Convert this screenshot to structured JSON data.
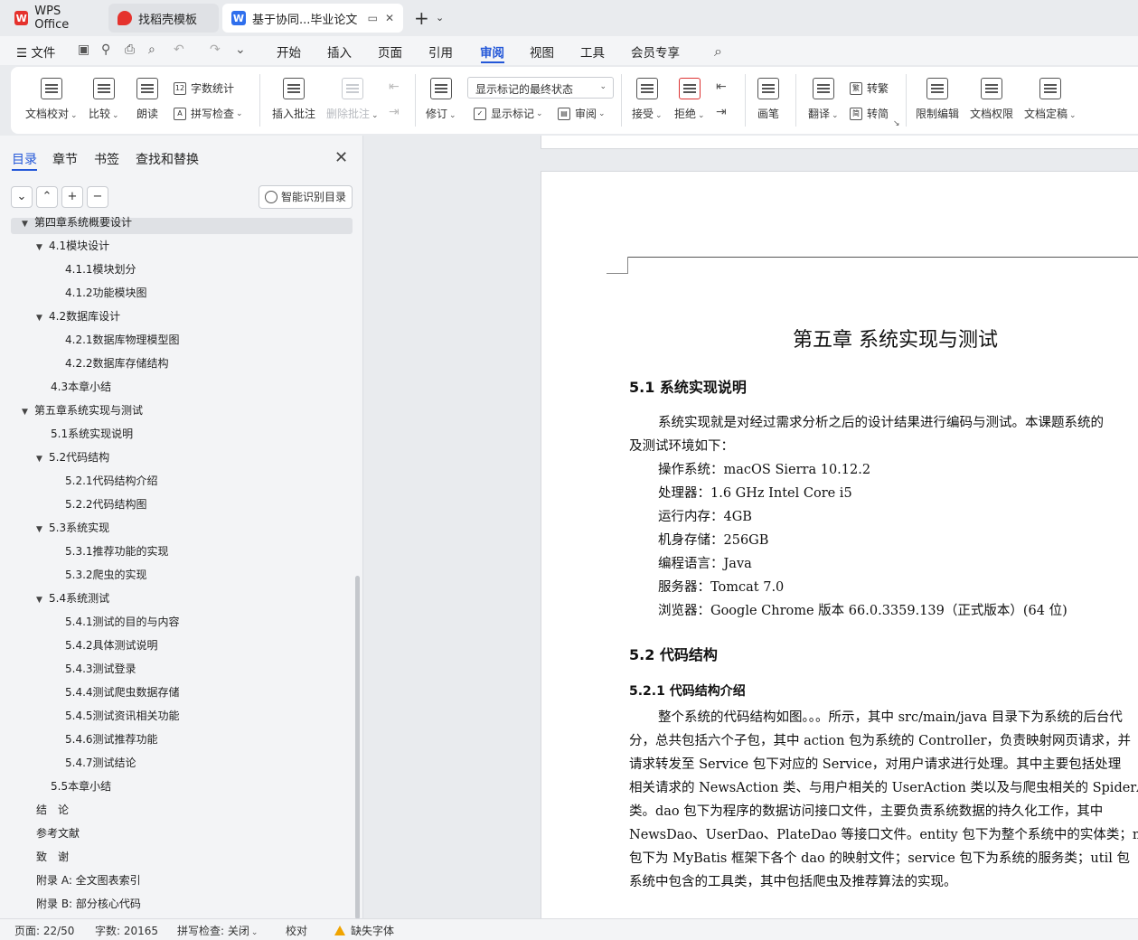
{
  "tabs": {
    "wps": "WPS Office",
    "templates": "找稻壳模板",
    "document": "基于协同...毕业论文"
  },
  "menubar": {
    "file": "文件",
    "items": [
      "开始",
      "插入",
      "页面",
      "引用",
      "审阅",
      "视图",
      "工具",
      "会员专享"
    ],
    "active": "审阅"
  },
  "ribbon": {
    "doc_proofread": "文档校对",
    "compare": "比较",
    "read_aloud": "朗读",
    "word_count": "字数统计",
    "spell_check": "拼写检查",
    "insert_comment": "插入批注",
    "delete_comment": "删除批注",
    "track_changes": "修订",
    "markup_state": "显示标记的最终状态",
    "show_markup": "显示标记",
    "review": "审阅",
    "accept": "接受",
    "reject": "拒绝",
    "pen": "画笔",
    "translate": "翻译",
    "to_traditional": "转繁",
    "to_simplified": "转简",
    "restrict_edit": "限制编辑",
    "doc_permission": "文档权限",
    "doc_finalize": "文档定稿"
  },
  "sidebar": {
    "tabs": [
      "目录",
      "章节",
      "书签",
      "查找和替换"
    ],
    "smart_toc": "智能识别目录",
    "toc": [
      {
        "label": "第四章系统概要设计",
        "level": 1,
        "caret": true
      },
      {
        "label": "4.1模块设计",
        "level": 2,
        "caret": true
      },
      {
        "label": "4.1.1模块划分",
        "level": 3,
        "caret": false
      },
      {
        "label": "4.1.2功能模块图",
        "level": 3,
        "caret": false
      },
      {
        "label": "4.2数据库设计",
        "level": 2,
        "caret": true
      },
      {
        "label": "4.2.1数据库物理模型图",
        "level": 3,
        "caret": false
      },
      {
        "label": "4.2.2数据库存储结构",
        "level": 3,
        "caret": false
      },
      {
        "label": "4.3本章小结",
        "level": 2,
        "caret": false
      },
      {
        "label": "第五章系统实现与测试",
        "level": 1,
        "caret": true
      },
      {
        "label": "5.1系统实现说明",
        "level": 2,
        "caret": false
      },
      {
        "label": "5.2代码结构",
        "level": 2,
        "caret": true
      },
      {
        "label": "5.2.1代码结构介绍",
        "level": 3,
        "caret": false
      },
      {
        "label": "5.2.2代码结构图",
        "level": 3,
        "caret": false
      },
      {
        "label": "5.3系统实现",
        "level": 2,
        "caret": true
      },
      {
        "label": "5.3.1推荐功能的实现",
        "level": 3,
        "caret": false
      },
      {
        "label": "5.3.2爬虫的实现",
        "level": 3,
        "caret": false
      },
      {
        "label": "5.4系统测试",
        "level": 2,
        "caret": true
      },
      {
        "label": "5.4.1测试的目的与内容",
        "level": 3,
        "caret": false
      },
      {
        "label": "5.4.2具体测试说明",
        "level": 3,
        "caret": false
      },
      {
        "label": "5.4.3测试登录",
        "level": 3,
        "caret": false
      },
      {
        "label": "5.4.4测试爬虫数据存储",
        "level": 3,
        "caret": false
      },
      {
        "label": "5.4.5测试资讯相关功能",
        "level": 3,
        "caret": false
      },
      {
        "label": "5.4.6测试推荐功能",
        "level": 3,
        "caret": false
      },
      {
        "label": "5.4.7测试结论",
        "level": 3,
        "caret": false
      },
      {
        "label": "5.5本章小结",
        "level": 2,
        "caret": false
      },
      {
        "label": "结　论",
        "level": 1,
        "caret": false
      },
      {
        "label": "参考文献",
        "level": 1,
        "caret": false
      },
      {
        "label": "致　谢",
        "level": 1,
        "caret": false
      },
      {
        "label": "附录 A:  全文图表索引",
        "level": 1,
        "caret": false
      },
      {
        "label": "附录 B:  部分核心代码",
        "level": 1,
        "caret": false
      }
    ]
  },
  "document": {
    "chapter_title": "第五章  系统实现与测试",
    "h_5_1": "5.1  系统实现说明",
    "p_5_1_line1": "系统实现就是对经过需求分析之后的设计结果进行编码与测试。本课题系统的",
    "p_5_1_line2": "及测试环境如下：",
    "env": [
      "操作系统：macOS Sierra 10.12.2",
      "处理器：1.6 GHz Intel Core i5",
      "运行内存：4GB",
      "机身存储：256GB",
      "编程语言：Java",
      "服务器：Tomcat 7.0",
      "浏览器：Google Chrome 版本  66.0.3359.139（正式版本）(64  位)"
    ],
    "h_5_2": "5.2  代码结构",
    "h_5_2_1": "5.2.1  代码结构介绍",
    "p_5_2_1": [
      "整个系统的代码结构如图。。。所示，其中 src/main/java 目录下为系统的后台代",
      "分，总共包括六个子包，其中 action 包为系统的 Controller，负责映射网页请求，并",
      "请求转发至 Service 包下对应的 Service，对用户请求进行处理。其中主要包括处理",
      "相关请求的 NewsAction 类、与用户相关的 UserAction 类以及与爬虫相关的 SpiderA",
      "类。dao 包下为程序的数据访问接口文件，主要负责系统数据的持久化工作，其中",
      "NewsDao、UserDao、PlateDao 等接口文件。entity 包下为整个系统中的实体类；m",
      "包下为 MyBatis 框架下各个 dao 的映射文件；service 包下为系统的服务类；util 包",
      "系统中包含的工具类，其中包括爬虫及推荐算法的实现。"
    ]
  },
  "statusbar": {
    "page": "页面: 22/50",
    "words": "字数: 20165",
    "spell": "拼写检查: 关闭",
    "proof": "校对",
    "missing_font": "缺失字体"
  }
}
